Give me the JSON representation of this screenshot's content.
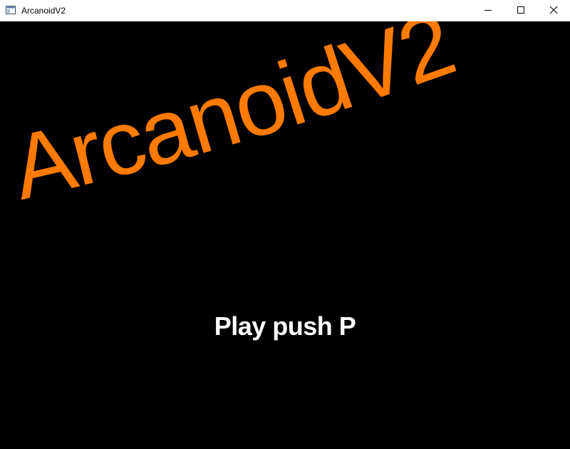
{
  "window": {
    "title": "ArcanoidV2",
    "controls": {
      "minimize_icon": "minimize-icon",
      "maximize_icon": "maximize-icon",
      "close_icon": "close-icon"
    }
  },
  "game": {
    "logo_text": "ArcanoidV2",
    "logo_color": "#ff7a00",
    "prompt": "Play push P",
    "prompt_color": "#ffffff",
    "background": "#000000"
  }
}
